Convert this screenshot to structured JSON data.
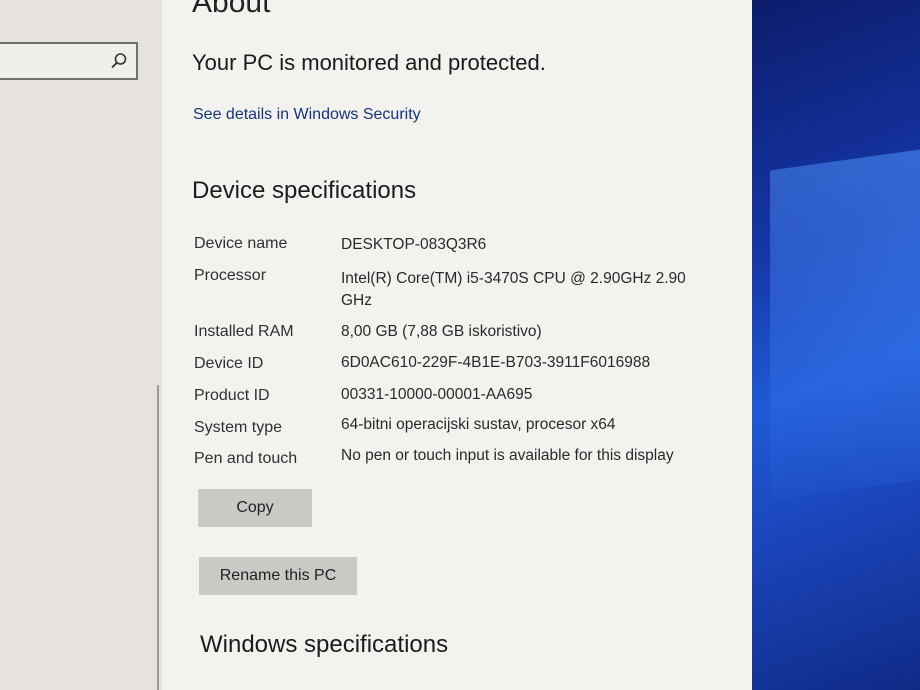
{
  "window": {
    "title": "About"
  },
  "security": {
    "status": "Your PC is monitored and protected.",
    "link_text": "See details in Windows Security"
  },
  "device_specs": {
    "heading": "Device specifications",
    "rows": [
      {
        "label": "Device name",
        "value": "DESKTOP-083Q3R6"
      },
      {
        "label": "Processor",
        "value": "Intel(R) Core(TM) i5-3470S CPU @ 2.90GHz   2.90 GHz"
      },
      {
        "label": "Installed RAM",
        "value": "8,00 GB (7,88 GB iskoristivo)"
      },
      {
        "label": "Device ID",
        "value": "6D0AC610-229F-4B1E-B703-3911F6016988"
      },
      {
        "label": "Product ID",
        "value": "00331-10000-00001-AA695"
      },
      {
        "label": "System type",
        "value": "64-bitni operacijski sustav, procesor x64"
      },
      {
        "label": "Pen and touch",
        "value": "No pen or touch input is available for this display"
      }
    ],
    "copy_label": "Copy",
    "rename_label": "Rename this PC"
  },
  "windows_specs": {
    "heading": "Windows specifications"
  },
  "icons": {
    "search": "search-icon"
  },
  "colors": {
    "link": "#16357e",
    "button": "#cbc9c6",
    "wallpaper": "#1f5ad6"
  }
}
